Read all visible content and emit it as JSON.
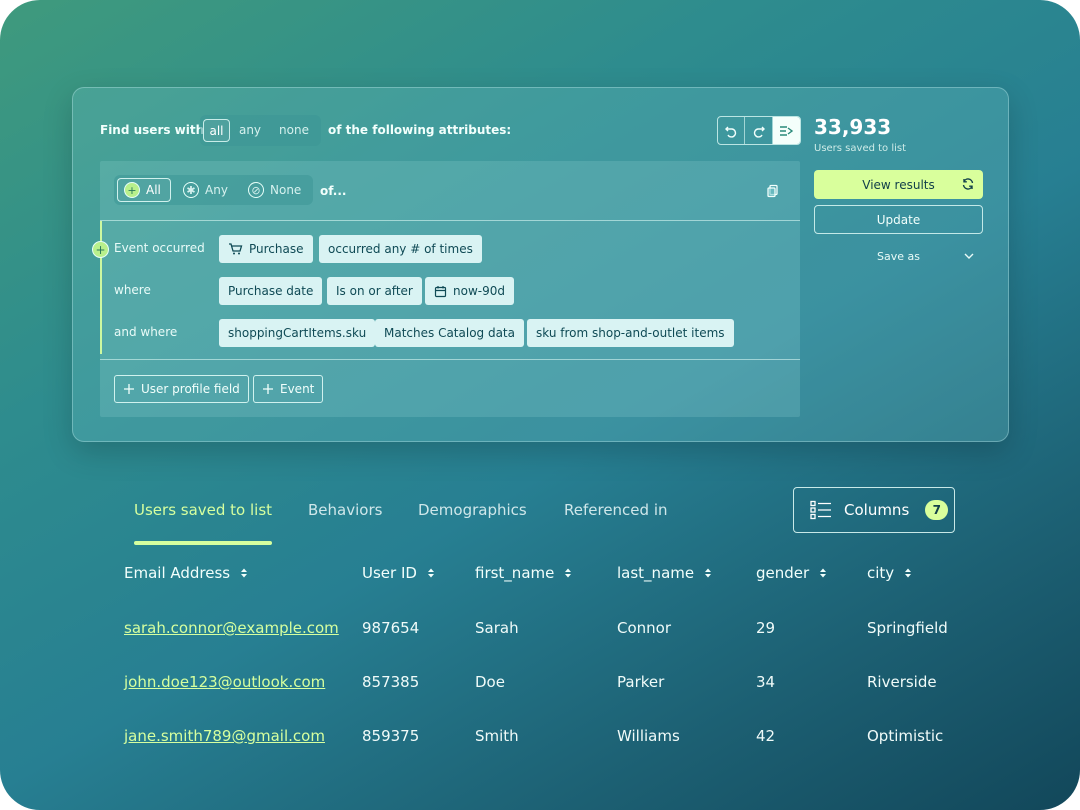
{
  "query": {
    "find_label": "Find users with",
    "modes": [
      "all",
      "any",
      "none"
    ],
    "active_mode": "all",
    "following_label": "of the following attributes:",
    "group_modes": [
      "All",
      "Any",
      "None"
    ],
    "of_label": "of...",
    "rows": [
      {
        "label": "Event occurred",
        "chips": [
          "Purchase",
          "occurred any # of times"
        ]
      },
      {
        "label": "where",
        "chips": [
          "Purchase date",
          "Is on or after",
          "now-90d"
        ]
      },
      {
        "label": "and where",
        "chips": [
          "shoppingCartItems.sku",
          "Matches Catalog data",
          "sku from shop-and-outlet items"
        ]
      }
    ],
    "add_buttons": [
      "User profile field",
      "Event"
    ]
  },
  "summary": {
    "count": "33,933",
    "count_label": "Users saved to list",
    "view_results": "View results",
    "update": "Update",
    "save_as": "Save as"
  },
  "tabs": [
    "Users saved to list",
    "Behaviors",
    "Demographics",
    "Referenced in"
  ],
  "active_tab": "Users saved to list",
  "columns_button": {
    "label": "Columns",
    "count": "7"
  },
  "table": {
    "headers": [
      "Email Address",
      "User ID",
      "first_name",
      "last_name",
      "gender",
      "city"
    ],
    "rows": [
      [
        "sarah.connor@example.com",
        "987654",
        "Sarah",
        "Connor",
        "29",
        "Springfield"
      ],
      [
        "john.doe123@outlook.com",
        "857385",
        "Doe",
        "Parker",
        "34",
        "Riverside"
      ],
      [
        "jane.smith789@gmail.com",
        "859375",
        "Smith",
        "Williams",
        "42",
        "Optimistic"
      ]
    ]
  },
  "colors": {
    "accent": "#d9ff9c",
    "chip_bg": "#d9f3f3",
    "chip_text": "#0f4a55"
  }
}
